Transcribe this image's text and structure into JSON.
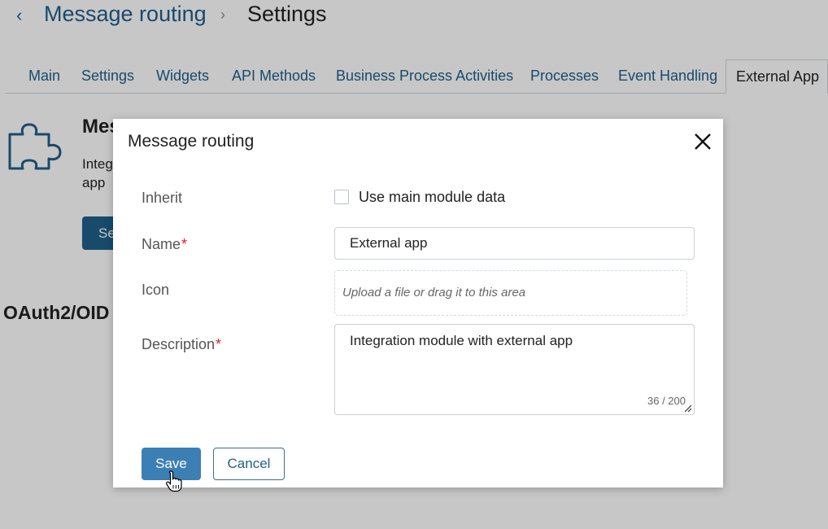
{
  "breadcrumb": {
    "back_icon": "chevron-left-icon",
    "parent": "Message routing",
    "separator": "›",
    "current": "Settings"
  },
  "tabs": [
    {
      "label": "Main"
    },
    {
      "label": "Settings"
    },
    {
      "label": "Widgets"
    },
    {
      "label": "API Methods"
    },
    {
      "label": "Business Process Activities"
    },
    {
      "label": "Processes"
    },
    {
      "label": "Event Handling"
    },
    {
      "label": "External App",
      "active": true
    }
  ],
  "module": {
    "icon": "puzzle-icon",
    "title": "Mes",
    "description": "Integ app",
    "button_label": "Se"
  },
  "section_title": "OAuth2/OID",
  "modal": {
    "title": "Message routing",
    "close_icon": "close-icon",
    "inherit": {
      "label": "Inherit",
      "checkbox_label": "Use main module data",
      "checked": false
    },
    "name": {
      "label": "Name",
      "required_mark": "*",
      "value": "External app"
    },
    "icon": {
      "label": "Icon",
      "placeholder": "Upload a file or drag it to this area"
    },
    "description": {
      "label": "Description",
      "required_mark": "*",
      "value": "Integration module with external app",
      "counter": "36 / 200"
    },
    "save_label": "Save",
    "cancel_label": "Cancel"
  },
  "colors": {
    "brand": "#1f5f8b",
    "primary_button": "#3b7fb4",
    "required": "#e02020"
  }
}
